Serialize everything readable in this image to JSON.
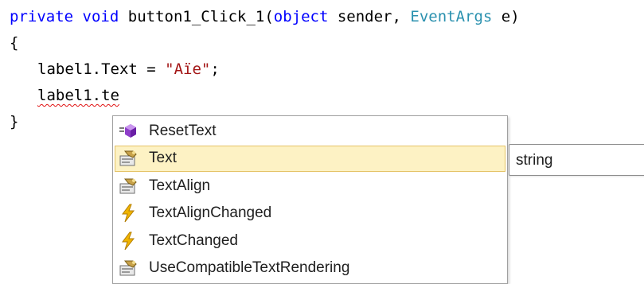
{
  "code": {
    "line1": {
      "kw_private": "private",
      "kw_void": "void",
      "method_name": "button1_Click_1(",
      "kw_object": "object",
      "param_sender": " sender, ",
      "type_eventargs": "EventArgs",
      "param_e": " e)"
    },
    "line2": {
      "text": "{"
    },
    "line3": {
      "prefix": "label1.Text = ",
      "string_value": "\"Aïe\"",
      "suffix": ";"
    },
    "line4": {
      "text": "label1.te"
    },
    "line5": {
      "text": "}"
    }
  },
  "completion_list": {
    "selected_index": 1,
    "items": [
      {
        "label": "ResetText",
        "icon": "method-icon"
      },
      {
        "label": "Text",
        "icon": "property-icon"
      },
      {
        "label": "TextAlign",
        "icon": "property-icon"
      },
      {
        "label": "TextAlignChanged",
        "icon": "event-icon"
      },
      {
        "label": "TextChanged",
        "icon": "event-icon"
      },
      {
        "label": "UseCompatibleTextRendering",
        "icon": "property-icon"
      }
    ]
  },
  "tooltip": {
    "text": "string"
  },
  "colors": {
    "keyword": "#0000ff",
    "type": "#2b91af",
    "string": "#a31515",
    "selection_bg": "#fdf2c4",
    "selection_border": "#e5c365",
    "squiggle": "#e01010"
  }
}
